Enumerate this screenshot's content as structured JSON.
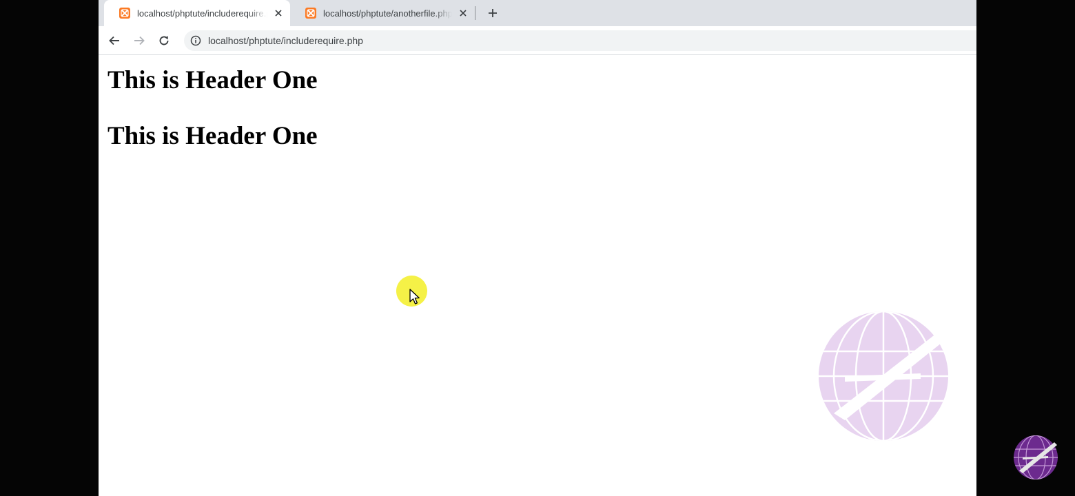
{
  "browser": {
    "tabs": [
      {
        "title": "localhost/phptute/includerequire.php",
        "active": true
      },
      {
        "title": "localhost/phptute/anotherfile.php",
        "active": false
      }
    ],
    "address_bar": {
      "url": "localhost/phptute/includerequire.php"
    }
  },
  "page": {
    "headings": [
      "This is Header One",
      "This is Header One"
    ]
  },
  "icons": {
    "favicon": "xampp-icon",
    "close": "close-icon",
    "new_tab": "plus-icon",
    "back": "arrow-left-icon",
    "forward": "arrow-right-icon",
    "reload": "reload-icon",
    "site_info": "info-icon",
    "cursor": "mouse-pointer-icon",
    "watermark": "globe-logo-icon"
  },
  "colors": {
    "tabstrip": "#dee1e6",
    "favicon": "#fb7a24",
    "cursor_highlight": "#f4ef33",
    "watermark": "#8e2fb6"
  }
}
